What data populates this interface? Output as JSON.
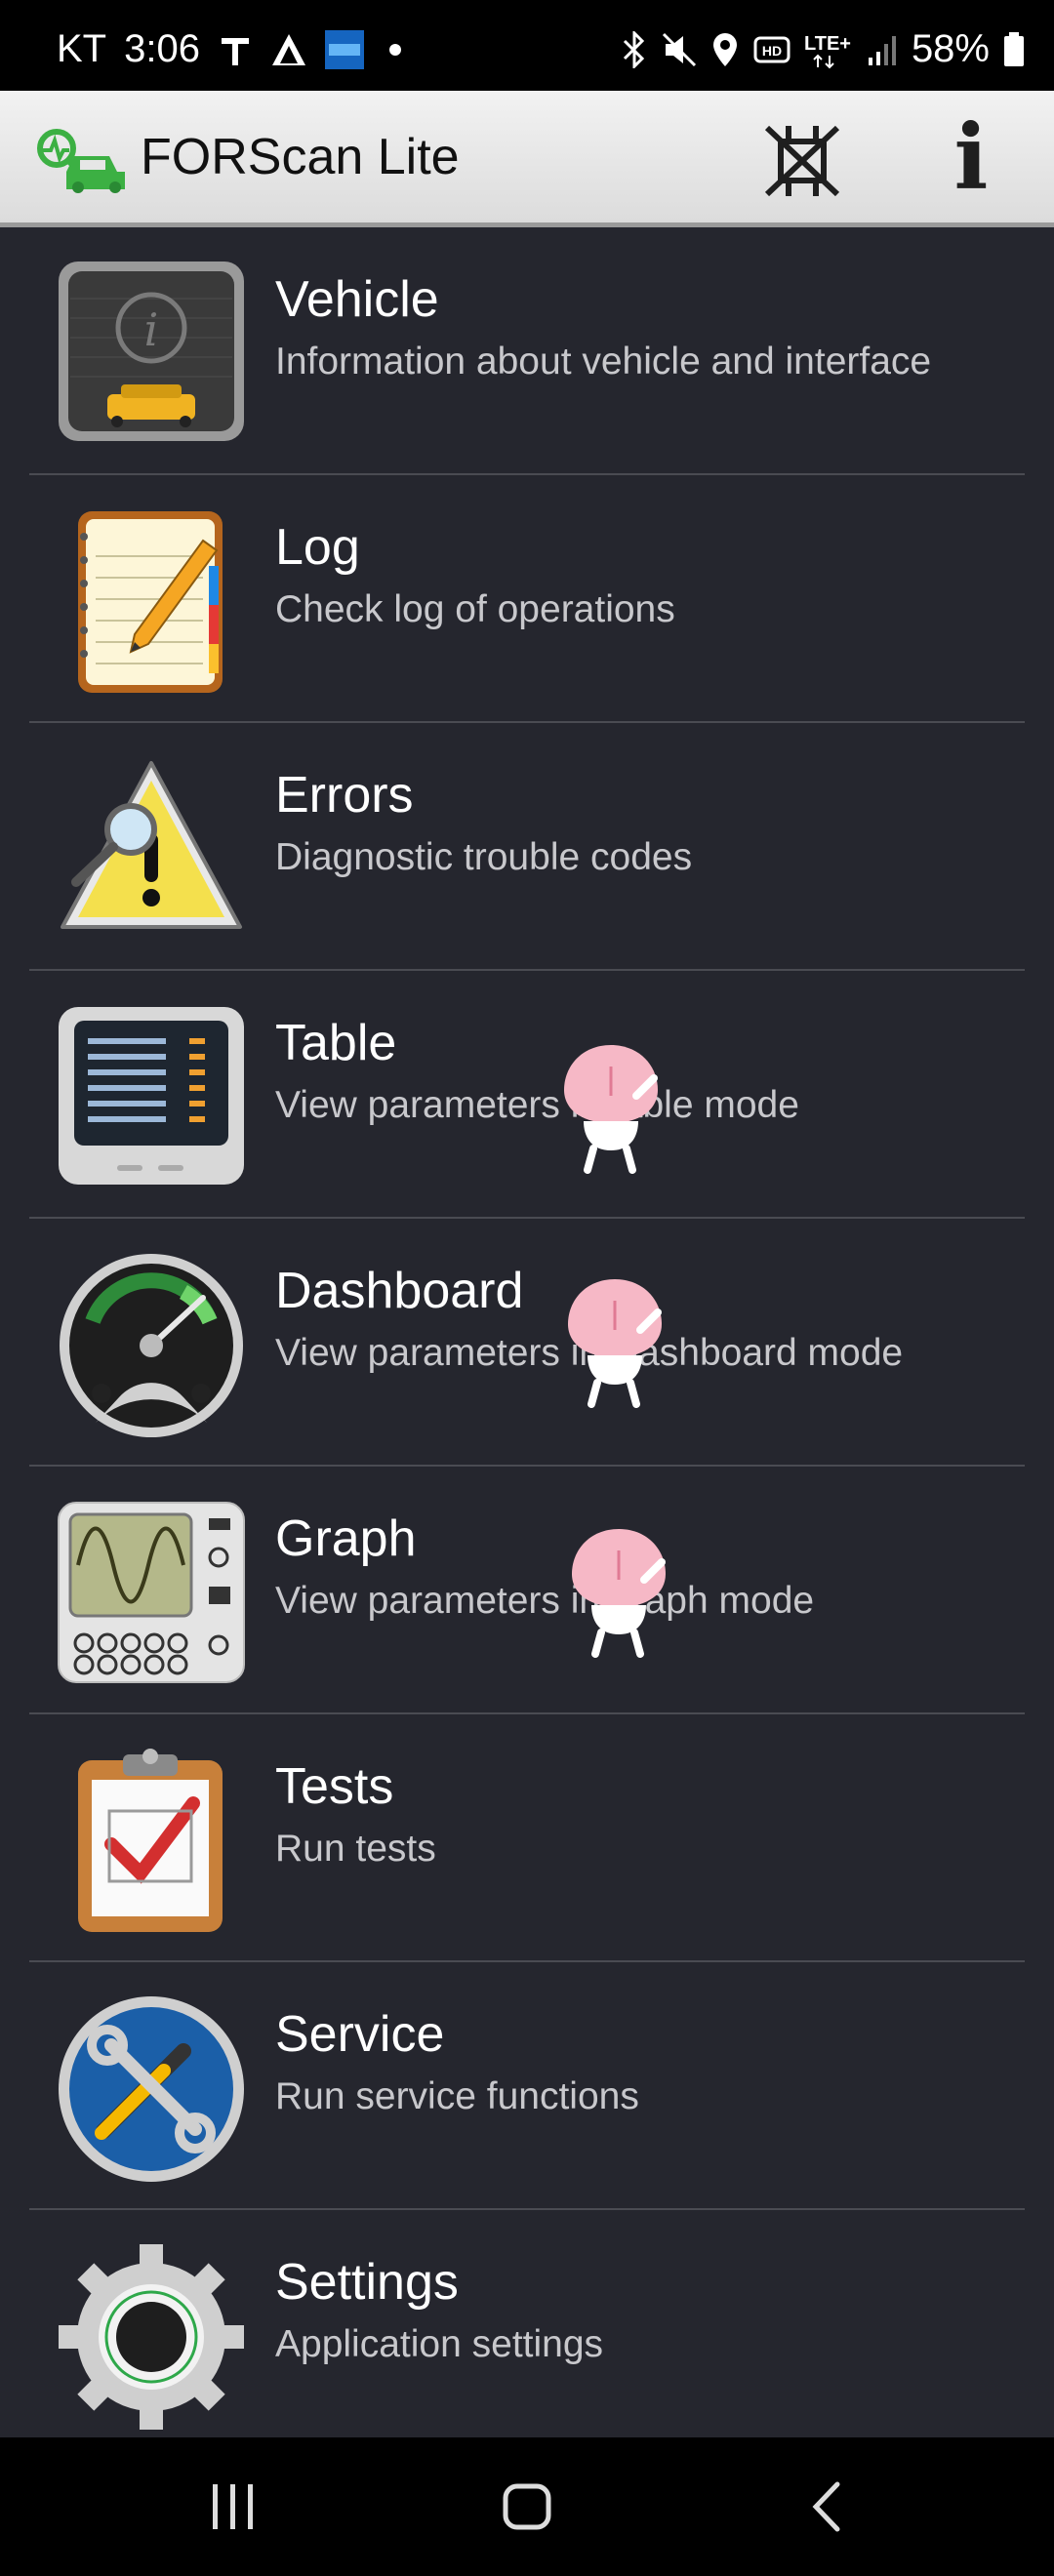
{
  "status_bar": {
    "carrier": "KT",
    "time": "3:06",
    "battery": "58%",
    "icons": [
      "t-icon",
      "navigation-icon",
      "app-notification-icon",
      "bluetooth-icon",
      "mute-icon",
      "location-icon",
      "hd-voice-icon",
      "lte-icon",
      "signal-icon",
      "battery-icon"
    ]
  },
  "app_bar": {
    "title": "FORScan Lite",
    "actions": [
      "connect-icon",
      "info-icon"
    ],
    "info_label": "i"
  },
  "menu": [
    {
      "key": "vehicle",
      "title": "Vehicle",
      "subtitle": "Information about vehicle and interface",
      "icon": "vehicle-info-icon"
    },
    {
      "key": "log",
      "title": "Log",
      "subtitle": "Check log of operations",
      "icon": "notepad-icon"
    },
    {
      "key": "errors",
      "title": "Errors",
      "subtitle": "Diagnostic trouble codes",
      "icon": "warning-magnifier-icon"
    },
    {
      "key": "table",
      "title": "Table",
      "subtitle": "View parameters in table mode",
      "icon": "monitor-table-icon"
    },
    {
      "key": "dashboard",
      "title": "Dashboard",
      "subtitle": "View parameters in Dashboard mode",
      "icon": "gauge-icon"
    },
    {
      "key": "graph",
      "title": "Graph",
      "subtitle": "View parameters in graph mode",
      "icon": "oscilloscope-icon"
    },
    {
      "key": "tests",
      "title": "Tests",
      "subtitle": "Run tests",
      "icon": "clipboard-check-icon"
    },
    {
      "key": "service",
      "title": "Service",
      "subtitle": "Run service functions",
      "icon": "wrench-screwdriver-icon"
    },
    {
      "key": "settings",
      "title": "Settings",
      "subtitle": "Application settings",
      "icon": "gear-icon"
    }
  ],
  "nav_bar": {
    "buttons": [
      "recent-apps-icon",
      "home-icon",
      "back-icon"
    ]
  },
  "colors": {
    "background": "#25262e",
    "divider": "#4a4b52",
    "title_text": "#ffffff",
    "subtitle_text": "#c8c8cc",
    "app_bar": "#e6e6e6",
    "logo_green": "#3cb043"
  }
}
